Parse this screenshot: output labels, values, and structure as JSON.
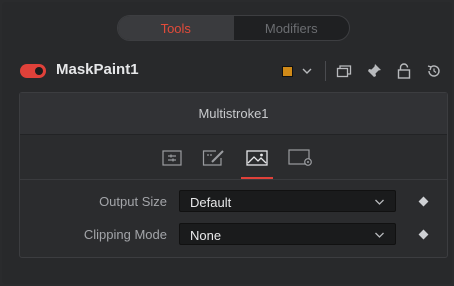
{
  "tabs": [
    {
      "label": "Tools",
      "active": true
    },
    {
      "label": "Modifiers",
      "active": false
    }
  ],
  "node": {
    "title": "MaskPaint1",
    "enabled": true,
    "color": "#d08a18",
    "header_icons": [
      "versions-icon",
      "pin-icon",
      "lock-icon",
      "reset-icon"
    ]
  },
  "panel": {
    "title": "Multistroke1",
    "subtabs": [
      {
        "icon": "controls-icon",
        "active": false
      },
      {
        "icon": "paint-icon",
        "active": false
      },
      {
        "icon": "image-icon",
        "active": true
      },
      {
        "icon": "settings-icon",
        "active": false
      }
    ],
    "fields": [
      {
        "label": "Output Size",
        "value": "Default"
      },
      {
        "label": "Clipping Mode",
        "value": "None"
      }
    ]
  },
  "colors": {
    "accent": "#e0413a",
    "panel": "#2b2c2e",
    "field": "#1a1b1c"
  }
}
